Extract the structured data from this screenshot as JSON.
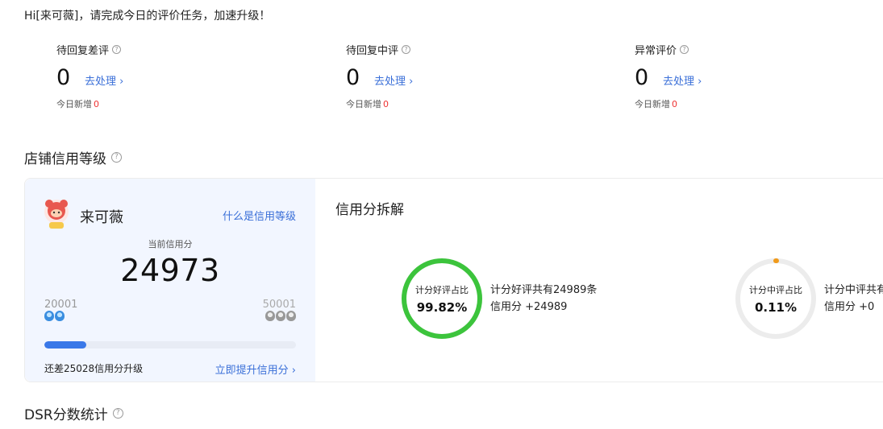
{
  "greeting": "Hi[来可薇]，请完成今日的评价任务，加速升级！",
  "stats": [
    {
      "title": "待回复差评",
      "value": "0",
      "link": "去处理",
      "today_label": "今日新增",
      "today_value": "0"
    },
    {
      "title": "待回复中评",
      "value": "0",
      "link": "去处理",
      "today_label": "今日新增",
      "today_value": "0"
    },
    {
      "title": "异常评价",
      "value": "0",
      "link": "去处理",
      "today_label": "今日新增",
      "today_value": "0"
    }
  ],
  "credit_section_title": "店铺信用等级",
  "shop": {
    "name": "来可薇",
    "what_link": "什么是信用等级",
    "current_label": "当前信用分",
    "current_score": "24973",
    "level_min": "20001",
    "level_max": "50001",
    "progress": 0.166,
    "gap_text": "还差25028信用分升级",
    "boost_link": "立即提升信用分"
  },
  "breakdown": {
    "title": "信用分拆解",
    "items": [
      {
        "label": "计分好评占比",
        "value": "99.82%",
        "ratio": 0.9982,
        "color": "#3cc43c",
        "desc1": "计分好评共有24989条",
        "desc2": "信用分 +24989"
      },
      {
        "label": "计分中评占比",
        "value": "0.11%",
        "ratio": 0.0011,
        "color": "#f09a1b",
        "desc1": "计分中评共有",
        "desc2": "信用分 +0"
      }
    ]
  },
  "dsr_section_title": "DSR分数统计",
  "colors": {
    "accent": "#3a6fd8",
    "progress": "#3a78e8",
    "alert": "#e33333"
  }
}
